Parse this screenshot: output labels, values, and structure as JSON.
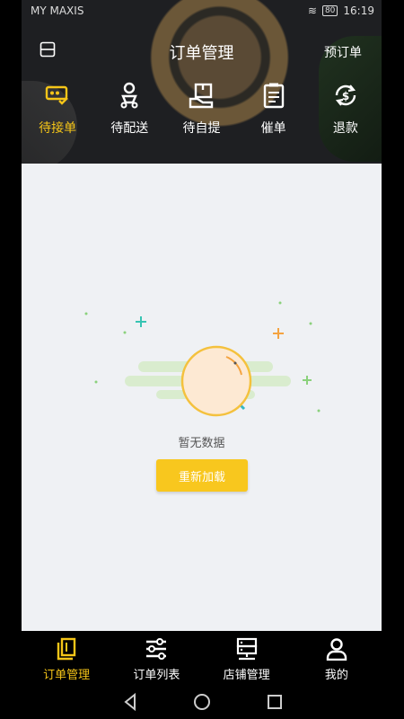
{
  "status_bar": {
    "carrier": "MY MAXIS",
    "battery": "80",
    "time": "16:19"
  },
  "topbar": {
    "title": "订单管理",
    "right_action": "预订单"
  },
  "tabs": [
    {
      "label": "待接单",
      "icon": "pending-order-icon",
      "active": true
    },
    {
      "label": "待配送",
      "icon": "delivery-scooter-icon",
      "active": false
    },
    {
      "label": "待自提",
      "icon": "self-pickup-icon",
      "active": false
    },
    {
      "label": "催单",
      "icon": "reminder-clipboard-icon",
      "active": false
    },
    {
      "label": "退款",
      "icon": "refund-icon",
      "active": false
    }
  ],
  "empty_state": {
    "message": "暂无数据",
    "reload_button": "重新加载"
  },
  "bottom_nav": [
    {
      "label": "订单管理",
      "icon": "order-management-icon",
      "active": true
    },
    {
      "label": "订单列表",
      "icon": "order-list-icon",
      "active": false
    },
    {
      "label": "店铺管理",
      "icon": "store-management-icon",
      "active": false
    },
    {
      "label": "我的",
      "icon": "profile-icon",
      "active": false
    }
  ],
  "colors": {
    "accent": "#f5c518",
    "button": "#f8c71e",
    "background": "#eff1f4"
  }
}
